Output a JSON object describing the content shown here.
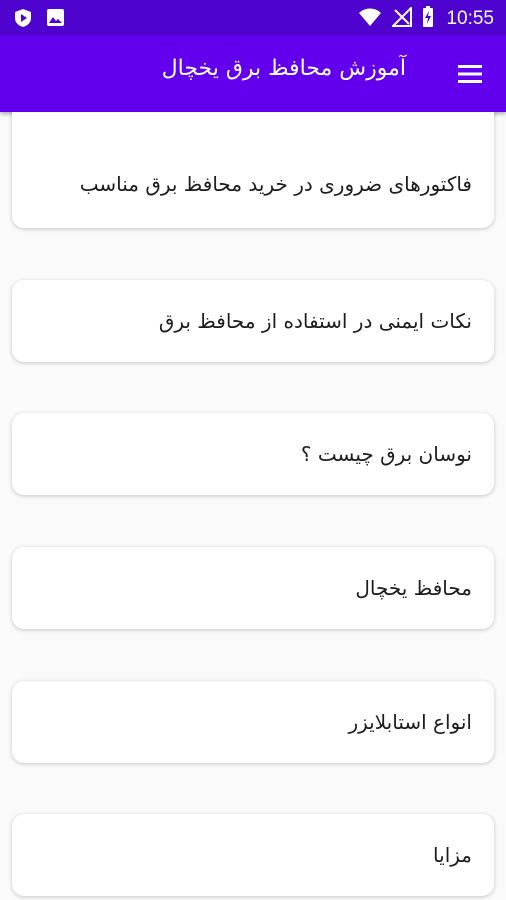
{
  "status_bar": {
    "time": "10:55",
    "icons": [
      "play-protect-icon",
      "image-icon",
      "wifi-icon",
      "no-signal-icon",
      "battery-charging-icon"
    ]
  },
  "app_bar": {
    "title": "آموزش محافظ برق یخچال",
    "menu_icon": "hamburger-menu-icon"
  },
  "items": [
    {
      "label": "فاکتورهای ضروری در خرید محافظ برق مناسب"
    },
    {
      "label": "نکات ایمنی در استفاده از محافظ برق"
    },
    {
      "label": "نوسان برق چیست ؟"
    },
    {
      "label": "محافظ یخچال"
    },
    {
      "label": "انواع استابلایزر"
    },
    {
      "label": "مزایا"
    }
  ],
  "colors": {
    "status_bar": "#4e03ce",
    "app_bar": "#6200ee",
    "background": "#fafafa",
    "card": "#ffffff"
  }
}
